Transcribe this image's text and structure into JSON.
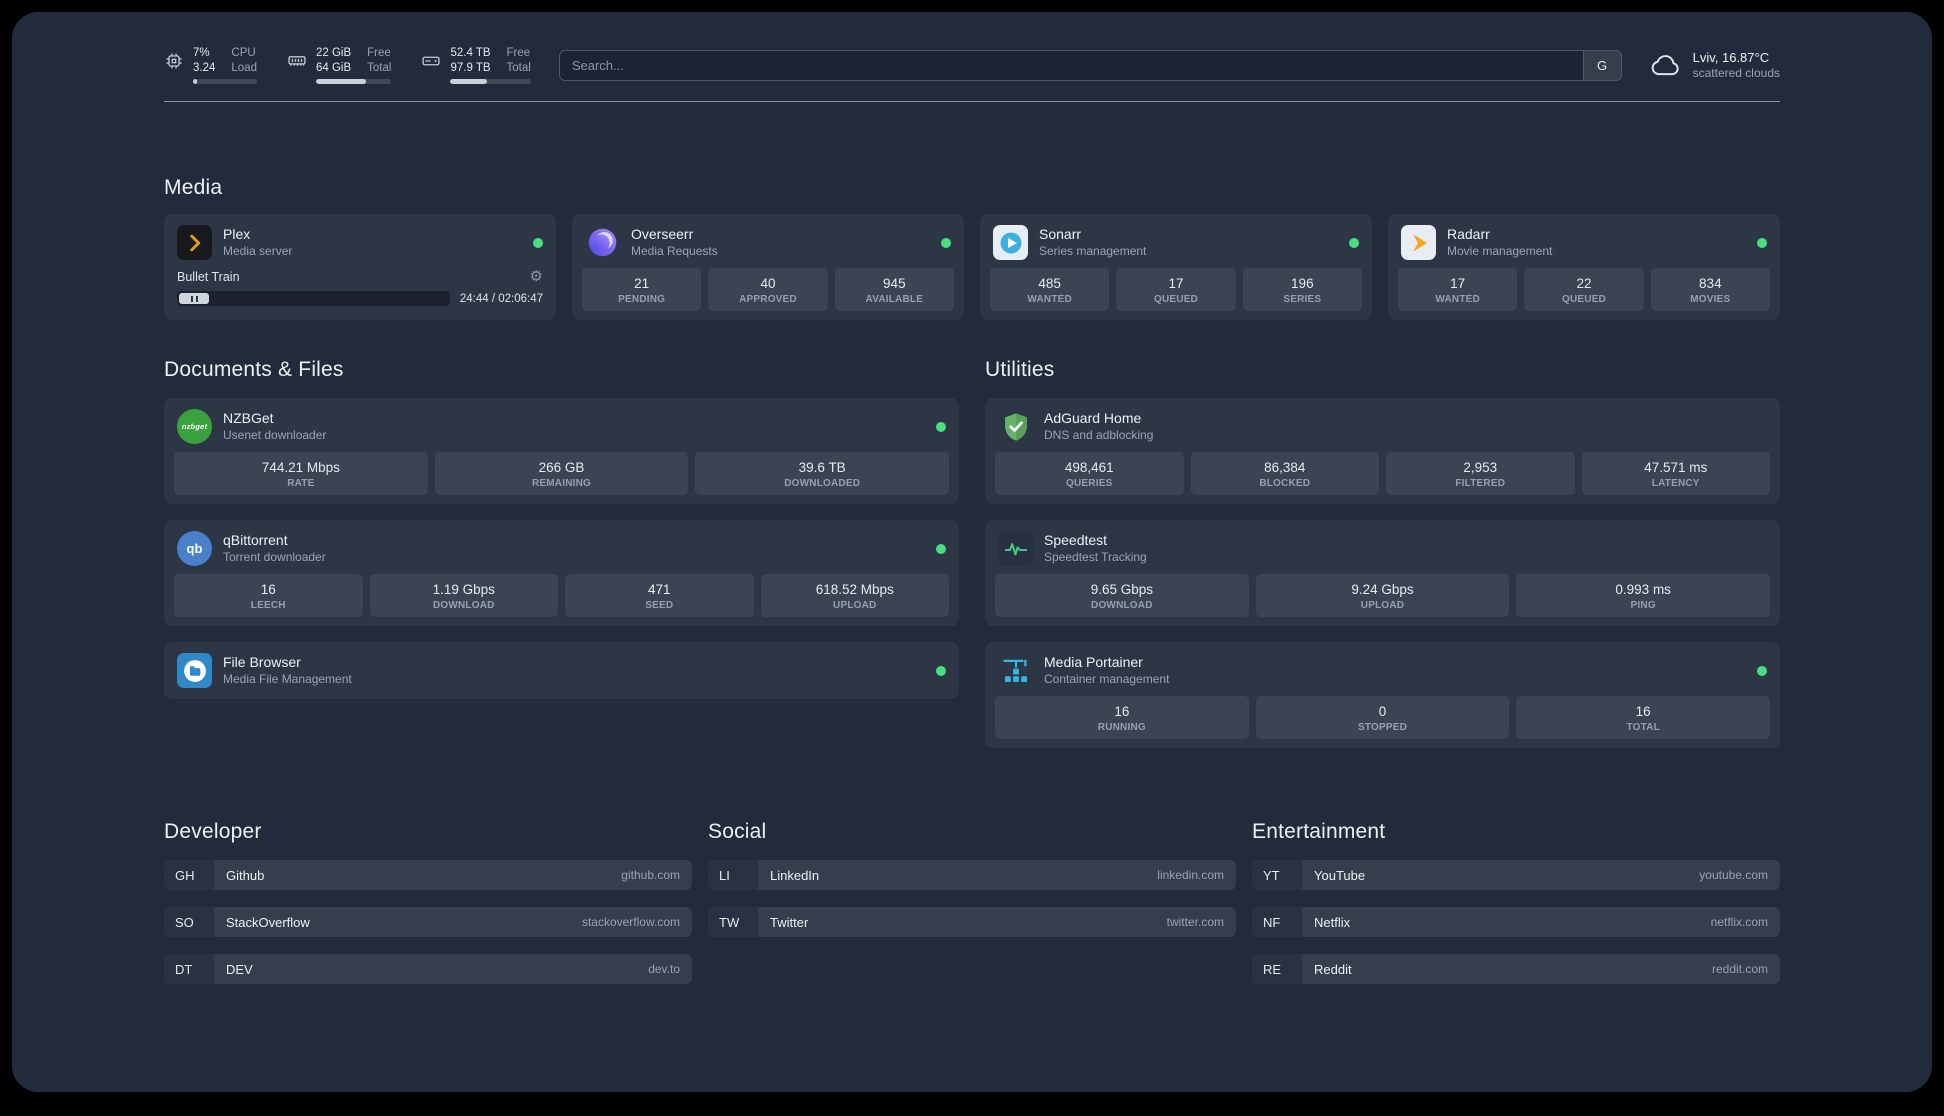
{
  "colors": {
    "page_background": "#212b3b",
    "status_online": "#4ade80",
    "plex_brand": "#e5a00d",
    "overseerr_brand": "#7c6cf0",
    "sonarr_brand": "#3db0e0",
    "radarr_brand": "#f7a823",
    "nzbget_brand": "#3aa13f",
    "qbittorrent_brand": "#4a7fc9",
    "filebrowser_brand": "#2f89c9",
    "adguard_brand": "#67b367",
    "speedtest_brand": "#44d07b",
    "portainer_brand": "#38b6e8"
  },
  "topbar": {
    "cpu": {
      "usage": "7%",
      "load": "3.24",
      "label_top": "CPU",
      "label_bottom": "Load",
      "bar_percent": 7
    },
    "memory": {
      "free": "22 GiB",
      "total": "64 GiB",
      "label_top": "Free",
      "label_bottom": "Total",
      "bar_percent": 66
    },
    "disk": {
      "free": "52.4 TB",
      "total": "97.9 TB",
      "label_top": "Free",
      "label_bottom": "Total",
      "bar_percent": 46
    },
    "search": {
      "placeholder": "Search...",
      "provider_button": "G"
    },
    "weather": {
      "location": "Lviv, 16.87°C",
      "condition": "scattered clouds",
      "icon": "cloud-icon"
    }
  },
  "sections": {
    "media": "Media",
    "documents": "Documents & Files",
    "utilities": "Utilities"
  },
  "services": {
    "plex": {
      "name": "Plex",
      "subtitle": "Media server",
      "now_playing": "Bullet Train",
      "elapsed": "24:44 / 02:06:47"
    },
    "overseerr": {
      "name": "Overseerr",
      "subtitle": "Media Requests",
      "stats": [
        {
          "value": "21",
          "label": "PENDING"
        },
        {
          "value": "40",
          "label": "APPROVED"
        },
        {
          "value": "945",
          "label": "AVAILABLE"
        }
      ]
    },
    "sonarr": {
      "name": "Sonarr",
      "subtitle": "Series management",
      "stats": [
        {
          "value": "485",
          "label": "WANTED"
        },
        {
          "value": "17",
          "label": "QUEUED"
        },
        {
          "value": "196",
          "label": "SERIES"
        }
      ]
    },
    "radarr": {
      "name": "Radarr",
      "subtitle": "Movie management",
      "stats": [
        {
          "value": "17",
          "label": "WANTED"
        },
        {
          "value": "22",
          "label": "QUEUED"
        },
        {
          "value": "834",
          "label": "MOVIES"
        }
      ]
    },
    "nzbget": {
      "name": "NZBGet",
      "subtitle": "Usenet downloader",
      "icon_text": "nzbget",
      "stats": [
        {
          "value": "744.21 Mbps",
          "label": "RATE"
        },
        {
          "value": "266 GB",
          "label": "REMAINING"
        },
        {
          "value": "39.6 TB",
          "label": "DOWNLOADED"
        }
      ]
    },
    "qbittorrent": {
      "name": "qBittorrent",
      "subtitle": "Torrent downloader",
      "icon_text": "qb",
      "stats": [
        {
          "value": "16",
          "label": "LEECH"
        },
        {
          "value": "1.19 Gbps",
          "label": "DOWNLOAD"
        },
        {
          "value": "471",
          "label": "SEED"
        },
        {
          "value": "618.52 Mbps",
          "label": "UPLOAD"
        }
      ]
    },
    "filebrowser": {
      "name": "File Browser",
      "subtitle": "Media File Management"
    },
    "adguard": {
      "name": "AdGuard Home",
      "subtitle": "DNS and adblocking",
      "stats": [
        {
          "value": "498,461",
          "label": "QUERIES"
        },
        {
          "value": "86,384",
          "label": "BLOCKED"
        },
        {
          "value": "2,953",
          "label": "FILTERED"
        },
        {
          "value": "47.571 ms",
          "label": "LATENCY"
        }
      ]
    },
    "speedtest": {
      "name": "Speedtest",
      "subtitle": "Speedtest Tracking",
      "stats": [
        {
          "value": "9.65 Gbps",
          "label": "DOWNLOAD"
        },
        {
          "value": "9.24 Gbps",
          "label": "UPLOAD"
        },
        {
          "value": "0.993 ms",
          "label": "PING"
        }
      ]
    },
    "portainer": {
      "name": "Media Portainer",
      "subtitle": "Container management",
      "stats": [
        {
          "value": "16",
          "label": "RUNNING"
        },
        {
          "value": "0",
          "label": "STOPPED"
        },
        {
          "value": "16",
          "label": "TOTAL"
        }
      ]
    }
  },
  "bookmark_groups": [
    {
      "title": "Developer",
      "items": [
        {
          "abbr": "GH",
          "name": "Github",
          "url": "github.com"
        },
        {
          "abbr": "SO",
          "name": "StackOverflow",
          "url": "stackoverflow.com"
        },
        {
          "abbr": "DT",
          "name": "DEV",
          "url": "dev.to"
        }
      ]
    },
    {
      "title": "Social",
      "items": [
        {
          "abbr": "LI",
          "name": "LinkedIn",
          "url": "linkedin.com"
        },
        {
          "abbr": "TW",
          "name": "Twitter",
          "url": "twitter.com"
        }
      ]
    },
    {
      "title": "Entertainment",
      "items": [
        {
          "abbr": "YT",
          "name": "YouTube",
          "url": "youtube.com"
        },
        {
          "abbr": "NF",
          "name": "Netflix",
          "url": "netflix.com"
        },
        {
          "abbr": "RE",
          "name": "Reddit",
          "url": "reddit.com"
        }
      ]
    }
  ]
}
